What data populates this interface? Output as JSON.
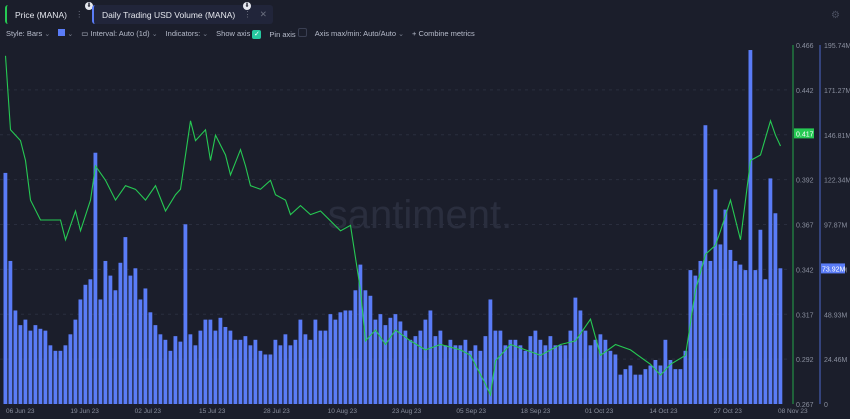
{
  "tabs": [
    {
      "label": "Price (MANA)",
      "color": "#26c953"
    },
    {
      "label": "Daily Trading USD Volume (MANA)",
      "color": "#5a7cf7"
    }
  ],
  "toolbar": {
    "style": "Style: Bars",
    "interval": "Interval: Auto (1d)",
    "indicators": "Indicators:",
    "show_axis": "Show axis",
    "show_axis_checked": true,
    "pin_axis": "Pin axis",
    "pin_axis_checked": false,
    "axis_maxmin": "Axis max/min: Auto/Auto",
    "combine": "Combine metrics"
  },
  "watermark": "santiment.",
  "chart_data": {
    "type": "bar+line",
    "x_ticks": [
      "06 Jun 23",
      "19 Jun 23",
      "02 Jul 23",
      "15 Jul 23",
      "28 Jul 23",
      "10 Aug 23",
      "23 Aug 23",
      "05 Sep 23",
      "18 Sep 23",
      "01 Oct 23",
      "14 Oct 23",
      "27 Oct 23",
      "08 Nov 23"
    ],
    "price_axis": {
      "ticks": [
        "0.466",
        "0.442",
        "0.417",
        "0.392",
        "0.367",
        "0.342",
        "0.317",
        "0.292",
        "0.267"
      ],
      "range": [
        0.267,
        0.466
      ],
      "current": "0.417"
    },
    "volume_axis": {
      "ticks": [
        "195.74M",
        "171.27M",
        "146.81M",
        "122.34M",
        "97.87M",
        "73.92M",
        "48.93M",
        "24.46M",
        "0"
      ],
      "range": [
        0,
        195.74
      ],
      "current": "73.92M"
    },
    "series": [
      {
        "name": "Daily Trading USD Volume (MANA)",
        "type": "bar",
        "unit": "M",
        "color": "#5a7cf7",
        "values": [
          126,
          78,
          51,
          43,
          46,
          40,
          43,
          41,
          40,
          32,
          29,
          29,
          32,
          38,
          46,
          57,
          65,
          68,
          137,
          57,
          78,
          70,
          62,
          77,
          91,
          70,
          74,
          57,
          63,
          50,
          43,
          38,
          35,
          29,
          37,
          34,
          98,
          38,
          32,
          40,
          46,
          46,
          40,
          47,
          42,
          40,
          35,
          35,
          37,
          32,
          35,
          29,
          27,
          27,
          35,
          32,
          38,
          32,
          35,
          46,
          38,
          35,
          46,
          40,
          40,
          49,
          46,
          50,
          51,
          51,
          62,
          76,
          62,
          59,
          46,
          49,
          43,
          47,
          49,
          45,
          40,
          35,
          37,
          40,
          46,
          51,
          37,
          40,
          32,
          35,
          32,
          32,
          35,
          29,
          32,
          29,
          37,
          57,
          40,
          40,
          32,
          35,
          35,
          32,
          29,
          37,
          40,
          35,
          32,
          37,
          32,
          32,
          32,
          40,
          58,
          51,
          40,
          32,
          35,
          38,
          35,
          29,
          27,
          16,
          19,
          21,
          16,
          16,
          19,
          21,
          24,
          21,
          35,
          24,
          19,
          19,
          29,
          73,
          70,
          78,
          152,
          78,
          117,
          87,
          106,
          84,
          78,
          76,
          73,
          193,
          73,
          95,
          68,
          123,
          104,
          74
        ]
      },
      {
        "name": "Price (MANA)",
        "type": "line",
        "color": "#26c953",
        "points": [
          [
            0,
            0.46
          ],
          [
            1,
            0.419
          ],
          [
            3,
            0.413
          ],
          [
            4,
            0.402
          ],
          [
            5,
            0.38
          ],
          [
            7,
            0.369
          ],
          [
            11,
            0.369
          ],
          [
            12,
            0.358
          ],
          [
            13,
            0.366
          ],
          [
            14,
            0.374
          ],
          [
            15,
            0.363
          ],
          [
            17,
            0.38
          ],
          [
            18,
            0.399
          ],
          [
            20,
            0.391
          ],
          [
            22,
            0.38
          ],
          [
            24,
            0.388
          ],
          [
            26,
            0.386
          ],
          [
            28,
            0.38
          ],
          [
            30,
            0.388
          ],
          [
            32,
            0.374
          ],
          [
            34,
            0.383
          ],
          [
            35,
            0.386
          ],
          [
            37,
            0.424
          ],
          [
            38,
            0.413
          ],
          [
            40,
            0.419
          ],
          [
            41,
            0.402
          ],
          [
            42,
            0.416
          ],
          [
            44,
            0.405
          ],
          [
            45,
            0.394
          ],
          [
            47,
            0.408
          ],
          [
            48,
            0.399
          ],
          [
            49,
            0.388
          ],
          [
            51,
            0.386
          ],
          [
            53,
            0.391
          ],
          [
            54,
            0.383
          ],
          [
            56,
            0.38
          ],
          [
            57,
            0.372
          ],
          [
            59,
            0.377
          ],
          [
            61,
            0.372
          ],
          [
            63,
            0.374
          ],
          [
            67,
            0.363
          ],
          [
            69,
            0.366
          ],
          [
            71,
            0.33
          ],
          [
            72,
            0.302
          ],
          [
            74,
            0.308
          ],
          [
            76,
            0.3
          ],
          [
            78,
            0.308
          ],
          [
            81,
            0.302
          ],
          [
            84,
            0.297
          ],
          [
            87,
            0.3
          ],
          [
            91,
            0.297
          ],
          [
            93,
            0.294
          ],
          [
            96,
            0.278
          ],
          [
            97,
            0.272
          ],
          [
            98,
            0.291
          ],
          [
            101,
            0.3
          ],
          [
            104,
            0.297
          ],
          [
            107,
            0.294
          ],
          [
            111,
            0.3
          ],
          [
            114,
            0.302
          ],
          [
            117,
            0.314
          ],
          [
            119,
            0.294
          ],
          [
            122,
            0.3
          ],
          [
            125,
            0.297
          ],
          [
            129,
            0.289
          ],
          [
            131,
            0.283
          ],
          [
            133,
            0.289
          ],
          [
            136,
            0.294
          ],
          [
            138,
            0.33
          ],
          [
            140,
            0.35
          ],
          [
            142,
            0.355
          ],
          [
            143,
            0.363
          ],
          [
            145,
            0.38
          ],
          [
            147,
            0.358
          ],
          [
            149,
            0.402
          ],
          [
            151,
            0.405
          ],
          [
            153,
            0.424
          ],
          [
            154,
            0.416
          ],
          [
            155,
            0.41
          ]
        ]
      }
    ]
  }
}
